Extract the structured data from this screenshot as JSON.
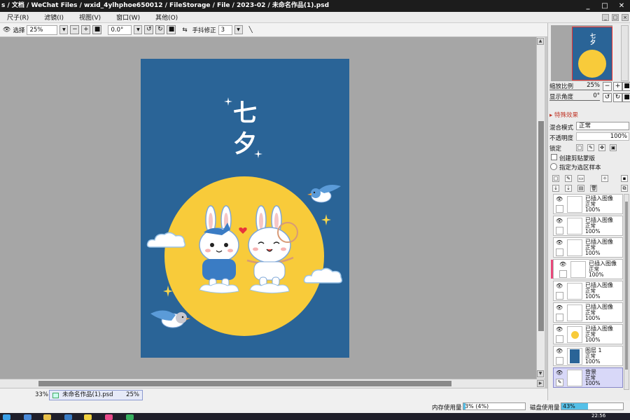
{
  "window": {
    "title": "s / 文档 / WeChat Files / wxid_4ylhphoe650012 / FileStorage / File / 2023-02 / 未命名作品(1).psd",
    "controls": [
      "_",
      "□",
      "✕"
    ]
  },
  "menu": {
    "items": [
      "尺子(R)",
      "滤镜(I)",
      "视图(V)",
      "窗口(W)",
      "其他(O)"
    ]
  },
  "toolbar": {
    "selection_label": "选择",
    "zoom_value": "25%",
    "angle_value": "0.0°",
    "stabilizer_label": "手抖修正",
    "stabilizer_value": "3"
  },
  "artwork": {
    "title": "七夕",
    "colors": {
      "background": "#2a6497",
      "moon": "#f8cb3a"
    }
  },
  "navigator": {
    "zoom_label": "缩放比例",
    "zoom_value": "25%",
    "angle_label": "显示角度",
    "angle_value": "0°"
  },
  "layer_props": {
    "effects_label": "特殊效果",
    "blend_label": "混合模式",
    "blend_value": "正常",
    "opacity_label": "不透明度",
    "opacity_value": "100%",
    "lock_label": "锁定",
    "clipping_label": "创建剪贴蒙版",
    "selection_source_label": "指定为选区样本"
  },
  "layers": [
    {
      "name": "已插入图像",
      "mode": "正常",
      "opacity": "100%",
      "thumb": "sketch"
    },
    {
      "name": "已插入图像",
      "mode": "正常",
      "opacity": "100%",
      "thumb": "sketch"
    },
    {
      "name": "已插入图像",
      "mode": "正常",
      "opacity": "100%",
      "thumb": "sketch"
    },
    {
      "name": "已插入图像",
      "mode": "正常",
      "opacity": "100%",
      "thumb": "sketch"
    },
    {
      "name": "已插入图像",
      "mode": "正常",
      "opacity": "100%",
      "thumb": "sketch"
    },
    {
      "name": "已插入图像",
      "mode": "正常",
      "opacity": "100%",
      "thumb": "sketch"
    },
    {
      "name": "已插入图像",
      "mode": "正常",
      "opacity": "100%",
      "thumb": "moon"
    },
    {
      "name": "图层 1",
      "mode": "正常",
      "opacity": "100%",
      "thumb": "blue"
    },
    {
      "name": "背景",
      "mode": "正常",
      "opacity": "100%",
      "thumb": "white"
    }
  ],
  "status": {
    "zoom_left": "33%",
    "document_name": "未命名作品(1).psd",
    "document_zoom": "25%"
  },
  "usage": {
    "memory_label": "内存使用量",
    "memory_text": "3% (4%)",
    "memory_fraction": 0.03,
    "disk_label": "磁盘使用量",
    "disk_text": "43%",
    "disk_fraction": 0.43
  },
  "taskbar": {
    "time": "22:56"
  }
}
